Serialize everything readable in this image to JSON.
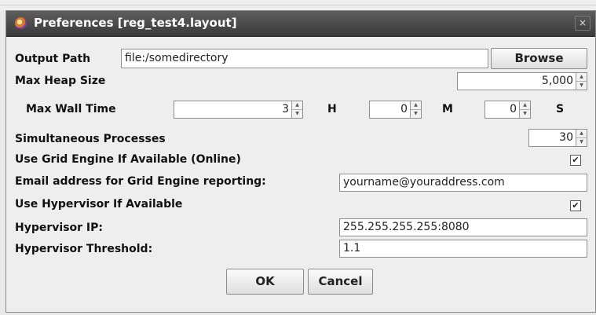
{
  "window": {
    "title": "Preferences [reg_test4.layout]",
    "close_glyph": "×",
    "app_icon": "app-logo-icon"
  },
  "output_path": {
    "label": "Output Path",
    "value": "file:/somedirectory",
    "browse_label": "Browse"
  },
  "max_heap": {
    "label": "Max Heap Size",
    "value": "5,000"
  },
  "max_wall_time": {
    "label": "Max Wall Time",
    "hours": "3",
    "hours_unit": "H",
    "minutes": "0",
    "minutes_unit": "M",
    "seconds": "0",
    "seconds_unit": "S"
  },
  "simultaneous": {
    "label": "Simultaneous Processes",
    "value": "30"
  },
  "grid_engine": {
    "label": "Use Grid Engine If Available (Online)",
    "checked": true
  },
  "email": {
    "label": "Email address for Grid Engine reporting:",
    "value": "yourname@youraddress.com"
  },
  "hypervisor": {
    "label": "Use Hypervisor If Available",
    "checked": true
  },
  "hypervisor_ip": {
    "label": "Hypervisor IP:",
    "value": "255.255.255.255:8080"
  },
  "hypervisor_threshold": {
    "label": "Hypervisor Threshold:",
    "value": "1.1"
  },
  "buttons": {
    "ok": "OK",
    "cancel": "Cancel"
  },
  "check_glyph": "✔",
  "spin_up": "▲",
  "spin_down": "▼"
}
